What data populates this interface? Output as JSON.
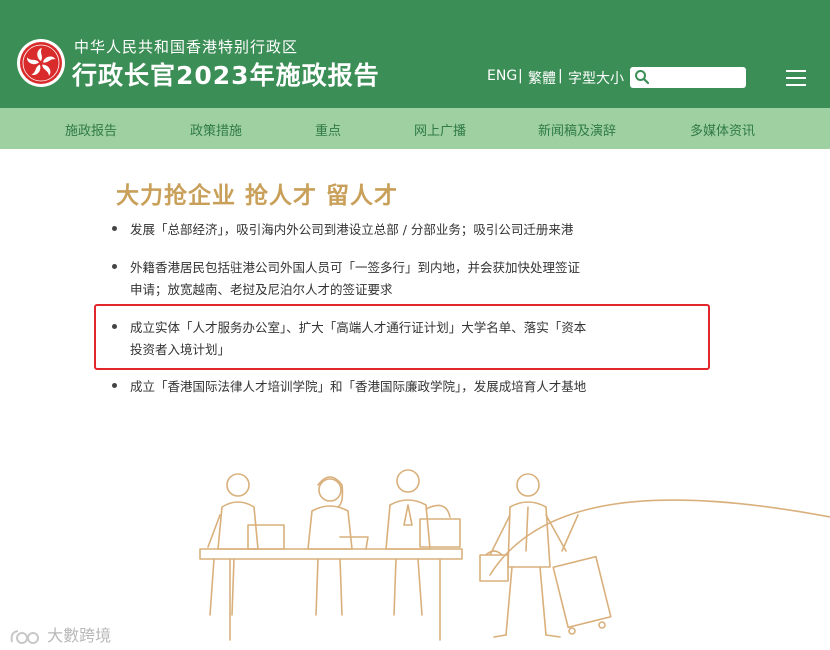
{
  "header": {
    "subtitle": "中华人民共和国香港特别行政区",
    "title": "行政长官2023年施政报告",
    "lang_eng": "ENG",
    "lang_trad": "繁體",
    "font_size": "字型大小",
    "separator": "|",
    "search_placeholder": ""
  },
  "nav": {
    "items": [
      "施政报告",
      "政策措施",
      "重点",
      "网上广播",
      "新闻稿及演辞",
      "多媒体资讯"
    ]
  },
  "main": {
    "heading": "大力抢企业 抢人才 留人才",
    "bullets": [
      "发展「总部经济」，吸引海内外公司到港设立总部 / 分部业务；吸引公司迁册来港",
      "外籍香港居民包括驻港公司外国人员可「一签多行」到内地，并会获加快处理签证申请；放宽越南、老挝及尼泊尔人才的签证要求",
      "成立实体「人才服务办公室」、扩大「高端人才通行证计划」大学名单、落实「资本投资者入境计划」",
      "成立「香港国际法律人才培训学院」和「香港国际廉政学院」，发展成培育人才基地"
    ]
  },
  "watermark": {
    "text": "大數跨境"
  },
  "colors": {
    "header_bg": "#3b8e56",
    "nav_bg": "#9fd0a2",
    "nav_text": "#2f7a45",
    "heading": "#c9a05a",
    "highlight": "#e2262b",
    "illustration": "#d9b07c"
  },
  "icons": [
    "bauhinia-logo-icon",
    "search-icon",
    "menu-icon"
  ]
}
